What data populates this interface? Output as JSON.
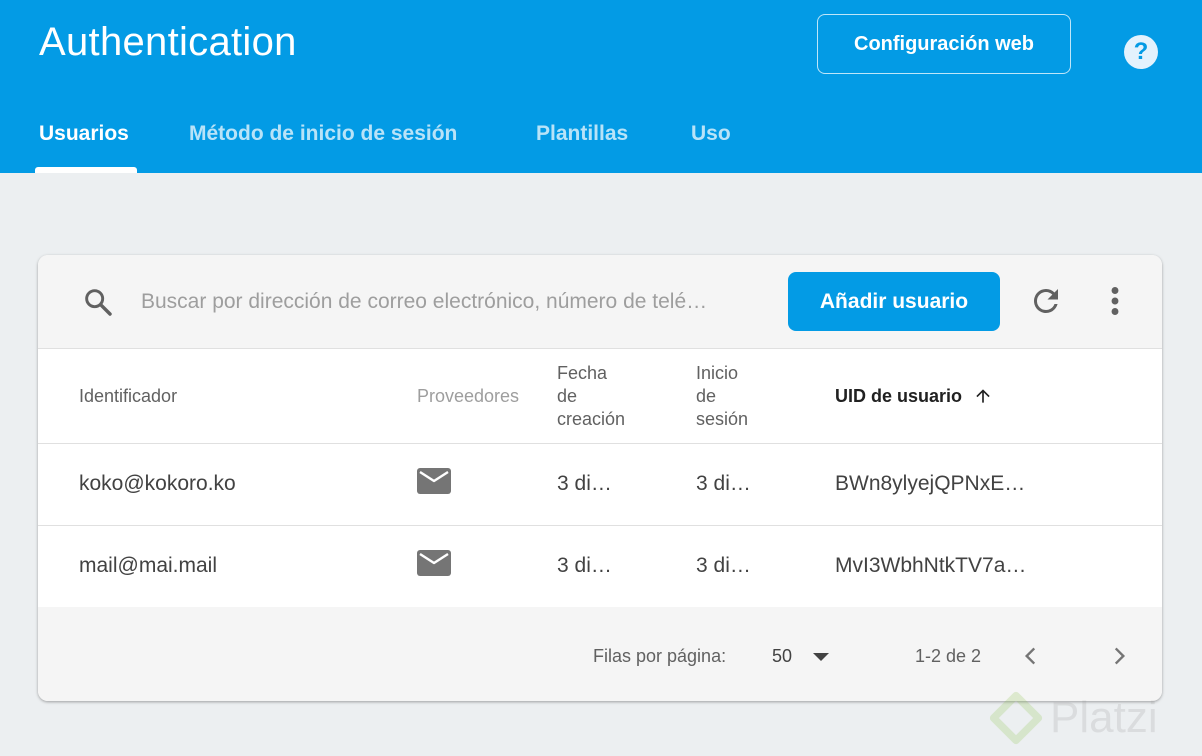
{
  "header": {
    "title": "Authentication",
    "config_button": "Configuración web",
    "help_icon": "help-circle-icon",
    "tabs": [
      {
        "label": "Usuarios",
        "active": true
      },
      {
        "label": "Método de inicio de sesión",
        "active": false
      },
      {
        "label": "Plantillas",
        "active": false
      },
      {
        "label": "Uso",
        "active": false
      }
    ]
  },
  "toolbar": {
    "search_placeholder": "Buscar por dirección de correo electrónico, número de telé…",
    "add_user_button": "Añadir usuario",
    "icons": [
      "search-icon",
      "refresh-icon",
      "more-vert-icon"
    ]
  },
  "table": {
    "columns": [
      "Identificador",
      "Proveedores",
      "Fecha de creación",
      "Inicio de sesión",
      "UID de usuario"
    ],
    "column_lines": {
      "created": [
        "Fecha",
        "de",
        "creación"
      ],
      "signin": [
        "Inicio",
        "de",
        "sesión"
      ]
    },
    "sorted_column": "UID de usuario",
    "sort_direction": "ascending",
    "rows": [
      {
        "identifier": "koko@kokoro.ko",
        "provider": "email-icon",
        "created": "3 di…",
        "signin": "3 di…",
        "uid": "BWn8ylyejQPNxE…"
      },
      {
        "identifier": "mail@mai.mail",
        "provider": "email-icon",
        "created": "3 di…",
        "signin": "3 di…",
        "uid": "MvI3WbhNtkTV7a…"
      }
    ]
  },
  "footer": {
    "rows_per_page_label": "Filas por página:",
    "rows_per_page_value": "50",
    "range": "1-2 de 2"
  },
  "watermark": {
    "text": "Platzi"
  },
  "colors": {
    "brand": "#039be5",
    "background": "#eceff1"
  }
}
